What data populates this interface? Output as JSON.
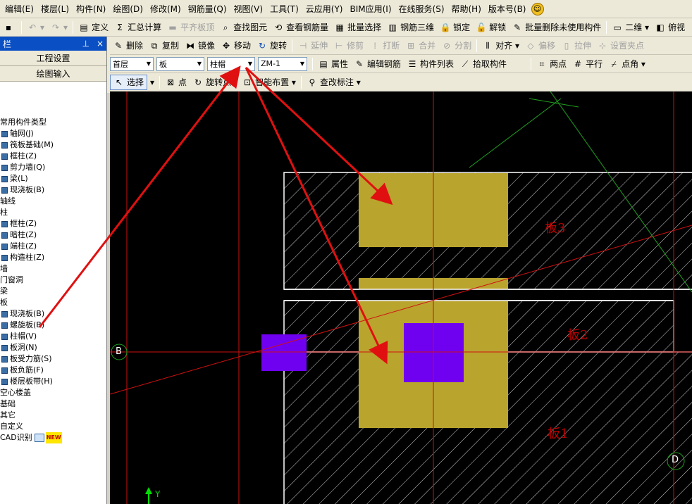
{
  "menu": {
    "items": [
      "编辑(E)",
      "楼层(L)",
      "构件(N)",
      "绘图(D)",
      "修改(M)",
      "钢筋量(Q)",
      "视图(V)",
      "工具(T)",
      "云应用(Y)",
      "BIM应用(I)",
      "在线服务(S)",
      "帮助(H)",
      "版本号(B)"
    ]
  },
  "toolbar1": {
    "define": "定义",
    "summary": "汇总计算",
    "flat_top": "平齐板顶",
    "find_element": "查找图元",
    "view_rebar": "查看钢筋量",
    "batch_select": "批量选择",
    "rebar_3d": "钢筋三维",
    "lock": "锁定",
    "unlock": "解锁",
    "batch_delete": "批量删除未使用构件",
    "view_2d": "二维",
    "top_view": "俯视"
  },
  "panel": {
    "title": "栏",
    "project_settings": "工程设置",
    "drawing_input": "绘图输入",
    "tree": [
      {
        "text": "常用构件类型",
        "level": 0,
        "icon": false
      },
      {
        "text": "轴网(J)",
        "level": 1,
        "icon": true
      },
      {
        "text": "筏板基础(M)",
        "level": 1,
        "icon": true
      },
      {
        "text": "框柱(Z)",
        "level": 1,
        "icon": true
      },
      {
        "text": "剪力墙(Q)",
        "level": 1,
        "icon": true
      },
      {
        "text": "梁(L)",
        "level": 1,
        "icon": true
      },
      {
        "text": "现浇板(B)",
        "level": 1,
        "icon": true
      },
      {
        "text": "轴线",
        "level": 0,
        "icon": false
      },
      {
        "text": "柱",
        "level": 0,
        "icon": false
      },
      {
        "text": "框柱(Z)",
        "level": 1,
        "icon": true
      },
      {
        "text": "暗柱(Z)",
        "level": 1,
        "icon": true
      },
      {
        "text": "端柱(Z)",
        "level": 1,
        "icon": true
      },
      {
        "text": "构造柱(Z)",
        "level": 1,
        "icon": true
      },
      {
        "text": "墙",
        "level": 0,
        "icon": false
      },
      {
        "text": "门窗洞",
        "level": 0,
        "icon": false
      },
      {
        "text": "梁",
        "level": 0,
        "icon": false
      },
      {
        "text": "板",
        "level": 0,
        "icon": false
      },
      {
        "text": "现浇板(B)",
        "level": 1,
        "icon": true
      },
      {
        "text": "螺旋板(B)",
        "level": 1,
        "icon": true
      },
      {
        "text": "柱帽(V)",
        "level": 1,
        "icon": true
      },
      {
        "text": "板洞(N)",
        "level": 1,
        "icon": true
      },
      {
        "text": "板受力筋(S)",
        "level": 1,
        "icon": true
      },
      {
        "text": "板负筋(F)",
        "level": 1,
        "icon": true
      },
      {
        "text": "楼层板带(H)",
        "level": 1,
        "icon": true
      },
      {
        "text": "空心楼盖",
        "level": 0,
        "icon": false
      },
      {
        "text": "基础",
        "level": 0,
        "icon": false
      },
      {
        "text": "其它",
        "level": 0,
        "icon": false
      },
      {
        "text": "自定义",
        "level": 0,
        "icon": false
      },
      {
        "text": "CAD识别",
        "level": 0,
        "icon": false
      }
    ],
    "new_badge": "NEW"
  },
  "toolbar2": {
    "delete": "删除",
    "copy": "复制",
    "mirror": "镜像",
    "move": "移动",
    "rotate": "旋转",
    "extend": "延伸",
    "trim": "修剪",
    "break": "打断",
    "merge": "合并",
    "split": "分割",
    "align": "对齐",
    "offset": "偏移",
    "stretch": "拉伸",
    "set_grip": "设置夹点"
  },
  "toolbar3": {
    "floor": "首层",
    "category": "板",
    "element_type": "柱帽",
    "element_name": "ZM-1",
    "properties": "属性",
    "edit_rebar": "编辑钢筋",
    "element_list": "构件列表",
    "pick_element": "拾取构件",
    "two_points": "两点",
    "parallel": "平行",
    "point_angle": "点角"
  },
  "toolbar4": {
    "select": "选择",
    "point": "点",
    "rotate_point": "旋转点",
    "smart_layout": "智能布置",
    "check_label": "查改标注"
  },
  "canvas": {
    "slab_labels": [
      "板3",
      "板2",
      "板1"
    ],
    "axis_labels": [
      "B",
      "D"
    ],
    "y_axis": "Y",
    "colors": {
      "background": "#000000",
      "column_cap": "#b9a42e",
      "column": "#7000f0",
      "slab_outline": "#ffffff",
      "hatch": "#cfcfcf",
      "axis_line": "#d01010",
      "annotation_arrow": "#e01010",
      "green_line": "#20a020"
    }
  }
}
